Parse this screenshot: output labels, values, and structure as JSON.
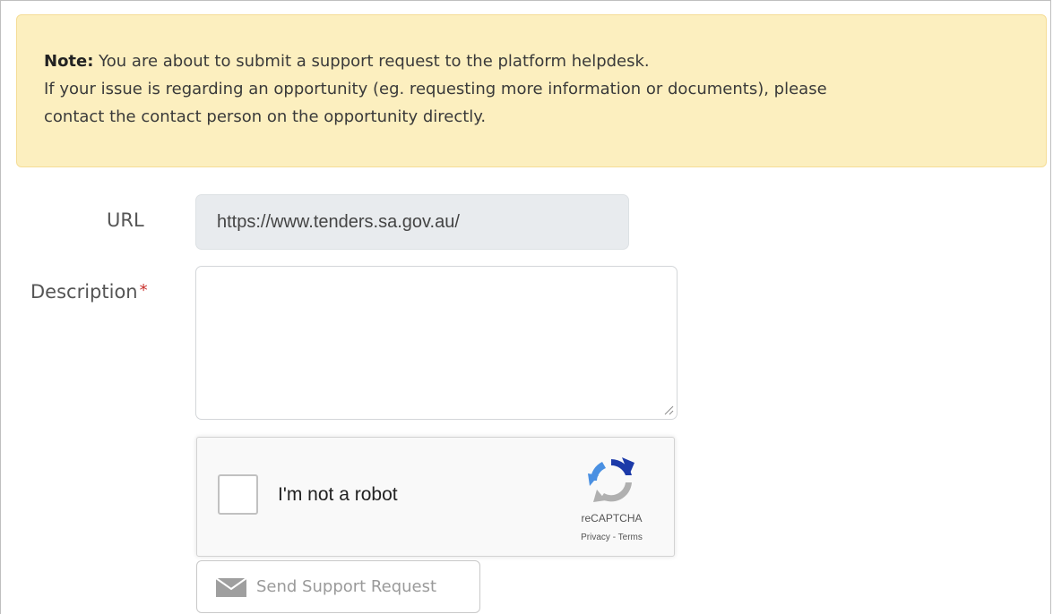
{
  "note": {
    "prefix": "Note:",
    "line1": " You are about to submit a support request to the platform helpdesk.",
    "line2": "If your issue is regarding an opportunity (eg. requesting more information or documents), please",
    "line3": "contact the contact person on the opportunity directly."
  },
  "form": {
    "url_label": "URL",
    "url_value": "https://www.tenders.sa.gov.au/",
    "description_label": "Description",
    "required_marker": "*",
    "description_value": ""
  },
  "captcha": {
    "label": "I'm not a robot",
    "brand": "reCAPTCHA",
    "privacy": "Privacy",
    "separator": " - ",
    "terms": "Terms"
  },
  "actions": {
    "send_label": "Send Support Request"
  },
  "colors": {
    "note_bg": "#fcefbf",
    "required": "#c9302c",
    "url_field_bg": "#e8ebee"
  },
  "icons": {
    "send": "envelope-icon",
    "recaptcha": "recaptcha-logo-icon",
    "resize": "resize-grip-icon"
  }
}
